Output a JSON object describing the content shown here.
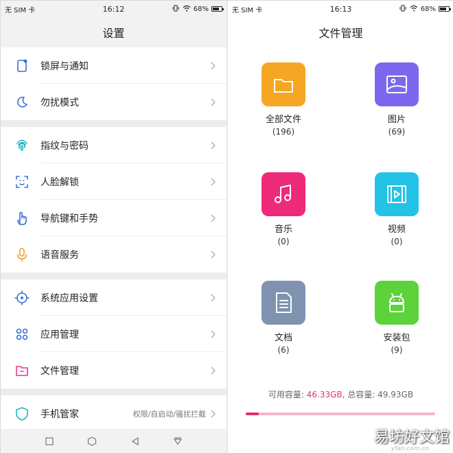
{
  "left_panel": {
    "status": {
      "carrier": "无 SIM 卡",
      "time": "16:12",
      "battery": "68%"
    },
    "title": "设置",
    "groups": [
      [
        {
          "label": "锁屏与通知",
          "icon": "lockscreen-icon",
          "color": "#3b6fd8"
        },
        {
          "label": "勿扰模式",
          "icon": "moon-icon",
          "color": "#3b6fd8"
        }
      ],
      [
        {
          "label": "指纹与密码",
          "icon": "fingerprint-icon",
          "color": "#19b3c9"
        },
        {
          "label": "人脸解锁",
          "icon": "face-unlock-icon",
          "color": "#3b6fd8"
        },
        {
          "label": "导航键和手势",
          "icon": "gesture-hand-icon",
          "color": "#3b6fd8"
        },
        {
          "label": "语音服务",
          "icon": "microphone-icon",
          "color": "#f0a030"
        }
      ],
      [
        {
          "label": "系统应用设置",
          "icon": "system-gear-icon",
          "color": "#3b6fd8"
        },
        {
          "label": "应用管理",
          "icon": "apps-grid-icon",
          "color": "#3b6fd8"
        },
        {
          "label": "文件管理",
          "icon": "folder-icon",
          "color": "#e03b8b"
        }
      ],
      [
        {
          "label": "手机管家",
          "icon": "shield-icon",
          "color": "#19b3c9",
          "sub": "权限/自启动/骚扰拦截"
        }
      ]
    ]
  },
  "right_panel": {
    "status": {
      "carrier": "无 SIM 卡",
      "time": "16:13",
      "battery": "68%"
    },
    "title": "文件管理",
    "tiles": [
      {
        "name": "全部文件",
        "count": "(196)",
        "color": "#f5a623",
        "icon": "folder-icon"
      },
      {
        "name": "图片",
        "count": "(69)",
        "color": "#7b68ee",
        "icon": "image-icon"
      },
      {
        "name": "音乐",
        "count": "(0)",
        "color": "#ee2a7b",
        "icon": "music-note-icon"
      },
      {
        "name": "视频",
        "count": "(0)",
        "color": "#22c3e6",
        "icon": "video-icon"
      },
      {
        "name": "文档",
        "count": "(6)",
        "color": "#7f93b0",
        "icon": "document-icon"
      },
      {
        "name": "安装包",
        "count": "(9)",
        "color": "#5cd33a",
        "icon": "android-icon"
      }
    ],
    "storage": {
      "available_label": "可用容量: ",
      "available_value": "46.33GB",
      "separator": ", ",
      "total_label": "总容量: ",
      "total_value": "49.93GB",
      "used_fraction": 0.07
    }
  },
  "watermark": {
    "text": "易坊好文馆",
    "url": "yfan.com.cn"
  }
}
